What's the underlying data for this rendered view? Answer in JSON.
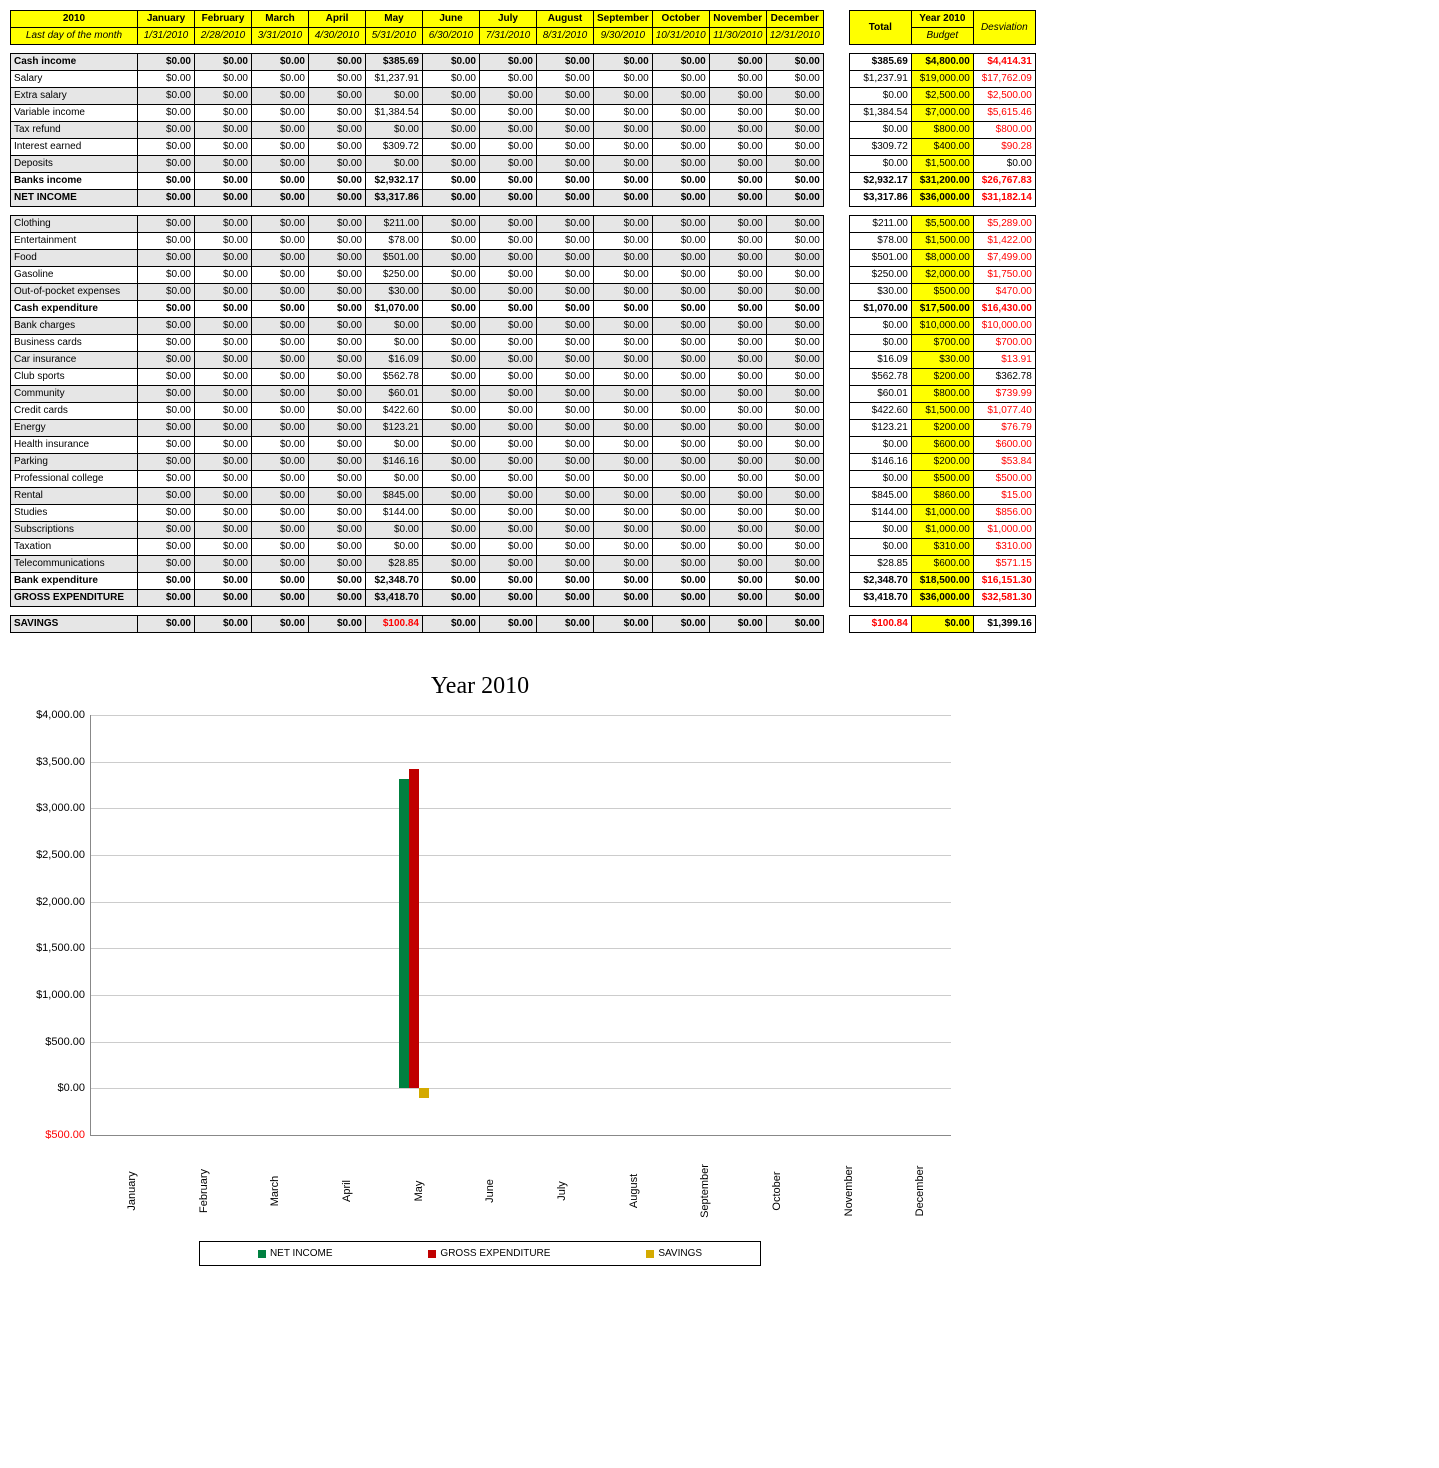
{
  "header": {
    "year": "2010",
    "year_sub": "Last day of the month",
    "months": [
      "January",
      "February",
      "March",
      "April",
      "May",
      "June",
      "July",
      "August",
      "September",
      "October",
      "November",
      "December"
    ],
    "dates": [
      "1/31/2010",
      "2/28/2010",
      "3/31/2010",
      "4/30/2010",
      "5/31/2010",
      "6/30/2010",
      "7/31/2010",
      "8/31/2010",
      "9/30/2010",
      "10/31/2010",
      "11/30/2010",
      "12/31/2010"
    ],
    "summary": {
      "total": "Total",
      "budget_top": "Year 2010",
      "budget_sub": "Budget",
      "dev": "Desviation"
    }
  },
  "sections": [
    {
      "rows": [
        {
          "label": "Cash income",
          "vals": [
            "$0.00",
            "$0.00",
            "$0.00",
            "$0.00",
            "$385.69",
            "$0.00",
            "$0.00",
            "$0.00",
            "$0.00",
            "$0.00",
            "$0.00",
            "$0.00"
          ],
          "alt": true,
          "bold": true,
          "total": "$385.69",
          "budget": "$4,800.00",
          "dev": "$4,414.31",
          "devred": true
        },
        {
          "label": "Salary",
          "vals": [
            "$0.00",
            "$0.00",
            "$0.00",
            "$0.00",
            "$1,237.91",
            "$0.00",
            "$0.00",
            "$0.00",
            "$0.00",
            "$0.00",
            "$0.00",
            "$0.00"
          ],
          "alt": false,
          "total": "$1,237.91",
          "budget": "$19,000.00",
          "dev": "$17,762.09",
          "devred": true
        },
        {
          "label": "Extra salary",
          "vals": [
            "$0.00",
            "$0.00",
            "$0.00",
            "$0.00",
            "$0.00",
            "$0.00",
            "$0.00",
            "$0.00",
            "$0.00",
            "$0.00",
            "$0.00",
            "$0.00"
          ],
          "alt": true,
          "total": "$0.00",
          "budget": "$2,500.00",
          "dev": "$2,500.00",
          "devred": true
        },
        {
          "label": "Variable income",
          "vals": [
            "$0.00",
            "$0.00",
            "$0.00",
            "$0.00",
            "$1,384.54",
            "$0.00",
            "$0.00",
            "$0.00",
            "$0.00",
            "$0.00",
            "$0.00",
            "$0.00"
          ],
          "alt": false,
          "total": "$1,384.54",
          "budget": "$7,000.00",
          "dev": "$5,615.46",
          "devred": true
        },
        {
          "label": "Tax refund",
          "vals": [
            "$0.00",
            "$0.00",
            "$0.00",
            "$0.00",
            "$0.00",
            "$0.00",
            "$0.00",
            "$0.00",
            "$0.00",
            "$0.00",
            "$0.00",
            "$0.00"
          ],
          "alt": true,
          "total": "$0.00",
          "budget": "$800.00",
          "dev": "$800.00",
          "devred": true
        },
        {
          "label": "Interest earned",
          "vals": [
            "$0.00",
            "$0.00",
            "$0.00",
            "$0.00",
            "$309.72",
            "$0.00",
            "$0.00",
            "$0.00",
            "$0.00",
            "$0.00",
            "$0.00",
            "$0.00"
          ],
          "alt": false,
          "total": "$309.72",
          "budget": "$400.00",
          "dev": "$90.28",
          "devred": true
        },
        {
          "label": "Deposits",
          "vals": [
            "$0.00",
            "$0.00",
            "$0.00",
            "$0.00",
            "$0.00",
            "$0.00",
            "$0.00",
            "$0.00",
            "$0.00",
            "$0.00",
            "$0.00",
            "$0.00"
          ],
          "alt": true,
          "total": "$0.00",
          "budget": "$1,500.00",
          "dev": "$0.00",
          "devred": false
        },
        {
          "label": "Banks income",
          "vals": [
            "$0.00",
            "$0.00",
            "$0.00",
            "$0.00",
            "$2,932.17",
            "$0.00",
            "$0.00",
            "$0.00",
            "$0.00",
            "$0.00",
            "$0.00",
            "$0.00"
          ],
          "alt": false,
          "bold": true,
          "total": "$2,932.17",
          "budget": "$31,200.00",
          "dev": "$26,767.83",
          "devred": true
        },
        {
          "label": "NET INCOME",
          "vals": [
            "$0.00",
            "$0.00",
            "$0.00",
            "$0.00",
            "$3,317.86",
            "$0.00",
            "$0.00",
            "$0.00",
            "$0.00",
            "$0.00",
            "$0.00",
            "$0.00"
          ],
          "alt": true,
          "bold": true,
          "total": "$3,317.86",
          "budget": "$36,000.00",
          "dev": "$31,182.14",
          "devred": true,
          "budbold": true
        }
      ]
    },
    {
      "rows": [
        {
          "label": "Clothing",
          "vals": [
            "$0.00",
            "$0.00",
            "$0.00",
            "$0.00",
            "$211.00",
            "$0.00",
            "$0.00",
            "$0.00",
            "$0.00",
            "$0.00",
            "$0.00",
            "$0.00"
          ],
          "alt": true,
          "total": "$211.00",
          "budget": "$5,500.00",
          "dev": "$5,289.00",
          "devred": true
        },
        {
          "label": "Entertainment",
          "vals": [
            "$0.00",
            "$0.00",
            "$0.00",
            "$0.00",
            "$78.00",
            "$0.00",
            "$0.00",
            "$0.00",
            "$0.00",
            "$0.00",
            "$0.00",
            "$0.00"
          ],
          "alt": false,
          "total": "$78.00",
          "budget": "$1,500.00",
          "dev": "$1,422.00",
          "devred": true
        },
        {
          "label": "Food",
          "vals": [
            "$0.00",
            "$0.00",
            "$0.00",
            "$0.00",
            "$501.00",
            "$0.00",
            "$0.00",
            "$0.00",
            "$0.00",
            "$0.00",
            "$0.00",
            "$0.00"
          ],
          "alt": true,
          "total": "$501.00",
          "budget": "$8,000.00",
          "dev": "$7,499.00",
          "devred": true
        },
        {
          "label": "Gasoline",
          "vals": [
            "$0.00",
            "$0.00",
            "$0.00",
            "$0.00",
            "$250.00",
            "$0.00",
            "$0.00",
            "$0.00",
            "$0.00",
            "$0.00",
            "$0.00",
            "$0.00"
          ],
          "alt": false,
          "total": "$250.00",
          "budget": "$2,000.00",
          "dev": "$1,750.00",
          "devred": true
        },
        {
          "label": "Out-of-pocket expenses",
          "vals": [
            "$0.00",
            "$0.00",
            "$0.00",
            "$0.00",
            "$30.00",
            "$0.00",
            "$0.00",
            "$0.00",
            "$0.00",
            "$0.00",
            "$0.00",
            "$0.00"
          ],
          "alt": true,
          "total": "$30.00",
          "budget": "$500.00",
          "dev": "$470.00",
          "devred": true
        },
        {
          "label": "Cash expenditure",
          "vals": [
            "$0.00",
            "$0.00",
            "$0.00",
            "$0.00",
            "$1,070.00",
            "$0.00",
            "$0.00",
            "$0.00",
            "$0.00",
            "$0.00",
            "$0.00",
            "$0.00"
          ],
          "alt": false,
          "bold": true,
          "total": "$1,070.00",
          "budget": "$17,500.00",
          "dev": "$16,430.00",
          "devred": true
        },
        {
          "label": "Bank charges",
          "vals": [
            "$0.00",
            "$0.00",
            "$0.00",
            "$0.00",
            "$0.00",
            "$0.00",
            "$0.00",
            "$0.00",
            "$0.00",
            "$0.00",
            "$0.00",
            "$0.00"
          ],
          "alt": true,
          "total": "$0.00",
          "budget": "$10,000.00",
          "dev": "$10,000.00",
          "devred": true
        },
        {
          "label": "Business cards",
          "vals": [
            "$0.00",
            "$0.00",
            "$0.00",
            "$0.00",
            "$0.00",
            "$0.00",
            "$0.00",
            "$0.00",
            "$0.00",
            "$0.00",
            "$0.00",
            "$0.00"
          ],
          "alt": false,
          "total": "$0.00",
          "budget": "$700.00",
          "dev": "$700.00",
          "devred": true
        },
        {
          "label": "Car insurance",
          "vals": [
            "$0.00",
            "$0.00",
            "$0.00",
            "$0.00",
            "$16.09",
            "$0.00",
            "$0.00",
            "$0.00",
            "$0.00",
            "$0.00",
            "$0.00",
            "$0.00"
          ],
          "alt": true,
          "total": "$16.09",
          "budget": "$30.00",
          "dev": "$13.91",
          "devred": true
        },
        {
          "label": "Club sports",
          "vals": [
            "$0.00",
            "$0.00",
            "$0.00",
            "$0.00",
            "$562.78",
            "$0.00",
            "$0.00",
            "$0.00",
            "$0.00",
            "$0.00",
            "$0.00",
            "$0.00"
          ],
          "alt": false,
          "total": "$562.78",
          "budget": "$200.00",
          "dev": "$362.78",
          "devred": false
        },
        {
          "label": "Community",
          "vals": [
            "$0.00",
            "$0.00",
            "$0.00",
            "$0.00",
            "$60.01",
            "$0.00",
            "$0.00",
            "$0.00",
            "$0.00",
            "$0.00",
            "$0.00",
            "$0.00"
          ],
          "alt": true,
          "total": "$60.01",
          "budget": "$800.00",
          "dev": "$739.99",
          "devred": true
        },
        {
          "label": "Credit cards",
          "vals": [
            "$0.00",
            "$0.00",
            "$0.00",
            "$0.00",
            "$422.60",
            "$0.00",
            "$0.00",
            "$0.00",
            "$0.00",
            "$0.00",
            "$0.00",
            "$0.00"
          ],
          "alt": false,
          "total": "$422.60",
          "budget": "$1,500.00",
          "dev": "$1,077.40",
          "devred": true
        },
        {
          "label": "Energy",
          "vals": [
            "$0.00",
            "$0.00",
            "$0.00",
            "$0.00",
            "$123.21",
            "$0.00",
            "$0.00",
            "$0.00",
            "$0.00",
            "$0.00",
            "$0.00",
            "$0.00"
          ],
          "alt": true,
          "total": "$123.21",
          "budget": "$200.00",
          "dev": "$76.79",
          "devred": true
        },
        {
          "label": "Health insurance",
          "vals": [
            "$0.00",
            "$0.00",
            "$0.00",
            "$0.00",
            "$0.00",
            "$0.00",
            "$0.00",
            "$0.00",
            "$0.00",
            "$0.00",
            "$0.00",
            "$0.00"
          ],
          "alt": false,
          "total": "$0.00",
          "budget": "$600.00",
          "dev": "$600.00",
          "devred": true
        },
        {
          "label": "Parking",
          "vals": [
            "$0.00",
            "$0.00",
            "$0.00",
            "$0.00",
            "$146.16",
            "$0.00",
            "$0.00",
            "$0.00",
            "$0.00",
            "$0.00",
            "$0.00",
            "$0.00"
          ],
          "alt": true,
          "total": "$146.16",
          "budget": "$200.00",
          "dev": "$53.84",
          "devred": true
        },
        {
          "label": "Professional college",
          "vals": [
            "$0.00",
            "$0.00",
            "$0.00",
            "$0.00",
            "$0.00",
            "$0.00",
            "$0.00",
            "$0.00",
            "$0.00",
            "$0.00",
            "$0.00",
            "$0.00"
          ],
          "alt": false,
          "total": "$0.00",
          "budget": "$500.00",
          "dev": "$500.00",
          "devred": true
        },
        {
          "label": "Rental",
          "vals": [
            "$0.00",
            "$0.00",
            "$0.00",
            "$0.00",
            "$845.00",
            "$0.00",
            "$0.00",
            "$0.00",
            "$0.00",
            "$0.00",
            "$0.00",
            "$0.00"
          ],
          "alt": true,
          "total": "$845.00",
          "budget": "$860.00",
          "dev": "$15.00",
          "devred": true
        },
        {
          "label": "Studies",
          "vals": [
            "$0.00",
            "$0.00",
            "$0.00",
            "$0.00",
            "$144.00",
            "$0.00",
            "$0.00",
            "$0.00",
            "$0.00",
            "$0.00",
            "$0.00",
            "$0.00"
          ],
          "alt": false,
          "total": "$144.00",
          "budget": "$1,000.00",
          "dev": "$856.00",
          "devred": true
        },
        {
          "label": "Subscriptions",
          "vals": [
            "$0.00",
            "$0.00",
            "$0.00",
            "$0.00",
            "$0.00",
            "$0.00",
            "$0.00",
            "$0.00",
            "$0.00",
            "$0.00",
            "$0.00",
            "$0.00"
          ],
          "alt": true,
          "total": "$0.00",
          "budget": "$1,000.00",
          "dev": "$1,000.00",
          "devred": true
        },
        {
          "label": "Taxation",
          "vals": [
            "$0.00",
            "$0.00",
            "$0.00",
            "$0.00",
            "$0.00",
            "$0.00",
            "$0.00",
            "$0.00",
            "$0.00",
            "$0.00",
            "$0.00",
            "$0.00"
          ],
          "alt": false,
          "total": "$0.00",
          "budget": "$310.00",
          "dev": "$310.00",
          "devred": true
        },
        {
          "label": "Telecommunications",
          "vals": [
            "$0.00",
            "$0.00",
            "$0.00",
            "$0.00",
            "$28.85",
            "$0.00",
            "$0.00",
            "$0.00",
            "$0.00",
            "$0.00",
            "$0.00",
            "$0.00"
          ],
          "alt": true,
          "total": "$28.85",
          "budget": "$600.00",
          "dev": "$571.15",
          "devred": true
        },
        {
          "label": "Bank expenditure",
          "vals": [
            "$0.00",
            "$0.00",
            "$0.00",
            "$0.00",
            "$2,348.70",
            "$0.00",
            "$0.00",
            "$0.00",
            "$0.00",
            "$0.00",
            "$0.00",
            "$0.00"
          ],
          "alt": false,
          "bold": true,
          "total": "$2,348.70",
          "budget": "$18,500.00",
          "dev": "$16,151.30",
          "devred": true
        },
        {
          "label": "GROSS EXPENDITURE",
          "vals": [
            "$0.00",
            "$0.00",
            "$0.00",
            "$0.00",
            "$3,418.70",
            "$0.00",
            "$0.00",
            "$0.00",
            "$0.00",
            "$0.00",
            "$0.00",
            "$0.00"
          ],
          "alt": true,
          "bold": true,
          "total": "$3,418.70",
          "budget": "$36,000.00",
          "dev": "$32,581.30",
          "devred": true,
          "budbold": true
        }
      ]
    },
    {
      "rows": [
        {
          "label": "SAVINGS",
          "vals": [
            "$0.00",
            "$0.00",
            "$0.00",
            "$0.00",
            "$100.84",
            "$0.00",
            "$0.00",
            "$0.00",
            "$0.00",
            "$0.00",
            "$0.00",
            "$0.00"
          ],
          "alt": true,
          "bold": true,
          "mayred": true,
          "total": "$100.84",
          "totalred": true,
          "budget": "$0.00",
          "dev": "$1,399.16",
          "devred": false,
          "budbold": true
        }
      ]
    }
  ],
  "chart_data": {
    "type": "bar",
    "title": "Year 2010",
    "categories": [
      "January",
      "February",
      "March",
      "April",
      "May",
      "June",
      "July",
      "August",
      "September",
      "October",
      "November",
      "December"
    ],
    "series": [
      {
        "name": "NET INCOME",
        "color": "#008040",
        "values": [
          0,
          0,
          0,
          0,
          3317.86,
          0,
          0,
          0,
          0,
          0,
          0,
          0
        ]
      },
      {
        "name": "GROSS EXPENDITURE",
        "color": "#c00000",
        "values": [
          0,
          0,
          0,
          0,
          3418.7,
          0,
          0,
          0,
          0,
          0,
          0,
          0
        ]
      },
      {
        "name": "SAVINGS",
        "color": "#d4aa00",
        "values": [
          0,
          0,
          0,
          0,
          -100.84,
          0,
          0,
          0,
          0,
          0,
          0,
          0
        ]
      }
    ],
    "ylim": [
      -500,
      4000
    ],
    "yticks": [
      {
        "v": -500,
        "l": "$500.00",
        "red": true
      },
      {
        "v": 0,
        "l": "$0.00"
      },
      {
        "v": 500,
        "l": "$500.00"
      },
      {
        "v": 1000,
        "l": "$1,000.00"
      },
      {
        "v": 1500,
        "l": "$1,500.00"
      },
      {
        "v": 2000,
        "l": "$2,000.00"
      },
      {
        "v": 2500,
        "l": "$2,500.00"
      },
      {
        "v": 3000,
        "l": "$3,000.00"
      },
      {
        "v": 3500,
        "l": "$3,500.00"
      },
      {
        "v": 4000,
        "l": "$4,000.00"
      }
    ]
  }
}
